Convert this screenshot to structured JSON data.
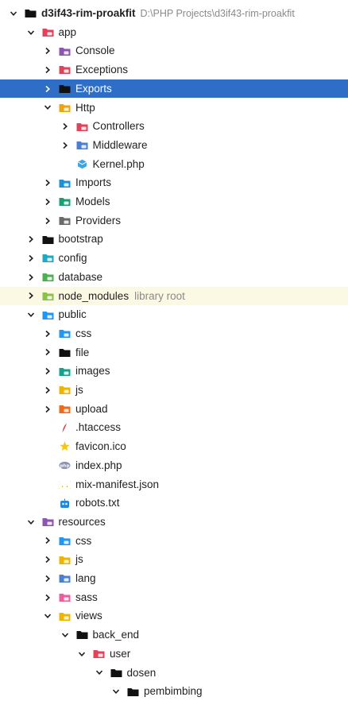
{
  "project": {
    "name": "d3if43-rim-proakfit",
    "path": "D:\\PHP Projects\\d3if43-rim-proakfit"
  },
  "tree": [
    {
      "label": "app",
      "depth": 1,
      "arrow": "down",
      "icon": "folder-app-icon",
      "color": "#e0435a"
    },
    {
      "label": "Console",
      "depth": 2,
      "arrow": "right",
      "icon": "folder-console-icon",
      "color": "#8e55b0"
    },
    {
      "label": "Exceptions",
      "depth": 2,
      "arrow": "right",
      "icon": "folder-exceptions-icon",
      "color": "#e0435a"
    },
    {
      "label": "Exports",
      "depth": 2,
      "arrow": "right",
      "icon": "folder-icon",
      "color": "#111111",
      "selected": true
    },
    {
      "label": "Http",
      "depth": 2,
      "arrow": "down",
      "icon": "folder-http-icon",
      "color": "#f0a30a"
    },
    {
      "label": "Controllers",
      "depth": 3,
      "arrow": "right",
      "icon": "folder-controllers-icon",
      "color": "#e0435a"
    },
    {
      "label": "Middleware",
      "depth": 3,
      "arrow": "right",
      "icon": "folder-middleware-icon",
      "color": "#4a7fd4"
    },
    {
      "label": "Kernel.php",
      "depth": 3,
      "arrow": "none",
      "icon": "kernel-file-icon",
      "color": "#3aa7e0"
    },
    {
      "label": "Imports",
      "depth": 2,
      "arrow": "right",
      "icon": "folder-imports-icon",
      "color": "#1e90d8"
    },
    {
      "label": "Models",
      "depth": 2,
      "arrow": "right",
      "icon": "folder-models-icon",
      "color": "#1b9e77"
    },
    {
      "label": "Providers",
      "depth": 2,
      "arrow": "right",
      "icon": "folder-providers-icon",
      "color": "#6a6a6a"
    },
    {
      "label": "bootstrap",
      "depth": 1,
      "arrow": "right",
      "icon": "folder-icon",
      "color": "#111111"
    },
    {
      "label": "config",
      "depth": 1,
      "arrow": "right",
      "icon": "folder-config-icon",
      "color": "#20a8c4"
    },
    {
      "label": "database",
      "depth": 1,
      "arrow": "right",
      "icon": "folder-database-icon",
      "color": "#4caf50"
    },
    {
      "label": "node_modules",
      "depth": 1,
      "arrow": "right",
      "icon": "folder-node-icon",
      "color": "#8bc34a",
      "hint": "library root",
      "excluded": true
    },
    {
      "label": "public",
      "depth": 1,
      "arrow": "down",
      "icon": "folder-public-icon",
      "color": "#2196f3"
    },
    {
      "label": "css",
      "depth": 2,
      "arrow": "right",
      "icon": "folder-css-icon",
      "color": "#2196f3"
    },
    {
      "label": "file",
      "depth": 2,
      "arrow": "right",
      "icon": "folder-icon",
      "color": "#111111"
    },
    {
      "label": "images",
      "depth": 2,
      "arrow": "right",
      "icon": "folder-images-icon",
      "color": "#12a48a"
    },
    {
      "label": "js",
      "depth": 2,
      "arrow": "right",
      "icon": "folder-js-icon",
      "color": "#f0b400"
    },
    {
      "label": "upload",
      "depth": 2,
      "arrow": "right",
      "icon": "folder-upload-icon",
      "color": "#f06a1a"
    },
    {
      "label": ".htaccess",
      "depth": 2,
      "arrow": "none",
      "icon": "htaccess-file-icon",
      "color": "#d2454b"
    },
    {
      "label": "favicon.ico",
      "depth": 2,
      "arrow": "none",
      "icon": "star-file-icon",
      "color": "#f5c518"
    },
    {
      "label": "index.php",
      "depth": 2,
      "arrow": "none",
      "icon": "php-file-icon",
      "color": "#8892bf"
    },
    {
      "label": "mix-manifest.json",
      "depth": 2,
      "arrow": "none",
      "icon": "json-file-icon",
      "color": "#c9a227"
    },
    {
      "label": "robots.txt",
      "depth": 2,
      "arrow": "none",
      "icon": "robot-file-icon",
      "color": "#1e88e5"
    },
    {
      "label": "resources",
      "depth": 1,
      "arrow": "down",
      "icon": "folder-resources-icon",
      "color": "#8e55b0"
    },
    {
      "label": "css",
      "depth": 2,
      "arrow": "right",
      "icon": "folder-css-icon",
      "color": "#2196f3"
    },
    {
      "label": "js",
      "depth": 2,
      "arrow": "right",
      "icon": "folder-js-icon",
      "color": "#f0b400"
    },
    {
      "label": "lang",
      "depth": 2,
      "arrow": "right",
      "icon": "folder-lang-icon",
      "color": "#4a7fd4"
    },
    {
      "label": "sass",
      "depth": 2,
      "arrow": "right",
      "icon": "folder-sass-icon",
      "color": "#ec5f9a"
    },
    {
      "label": "views",
      "depth": 2,
      "arrow": "down",
      "icon": "folder-views-icon",
      "color": "#f0b400"
    },
    {
      "label": "back_end",
      "depth": 3,
      "arrow": "down",
      "icon": "folder-icon",
      "color": "#111111"
    },
    {
      "label": "user",
      "depth": 4,
      "arrow": "down",
      "icon": "folder-user-icon",
      "color": "#e0435a"
    },
    {
      "label": "dosen",
      "depth": 5,
      "arrow": "down",
      "icon": "folder-icon",
      "color": "#111111"
    },
    {
      "label": "pembimbing",
      "depth": 6,
      "arrow": "down",
      "icon": "folder-icon",
      "color": "#111111"
    }
  ]
}
